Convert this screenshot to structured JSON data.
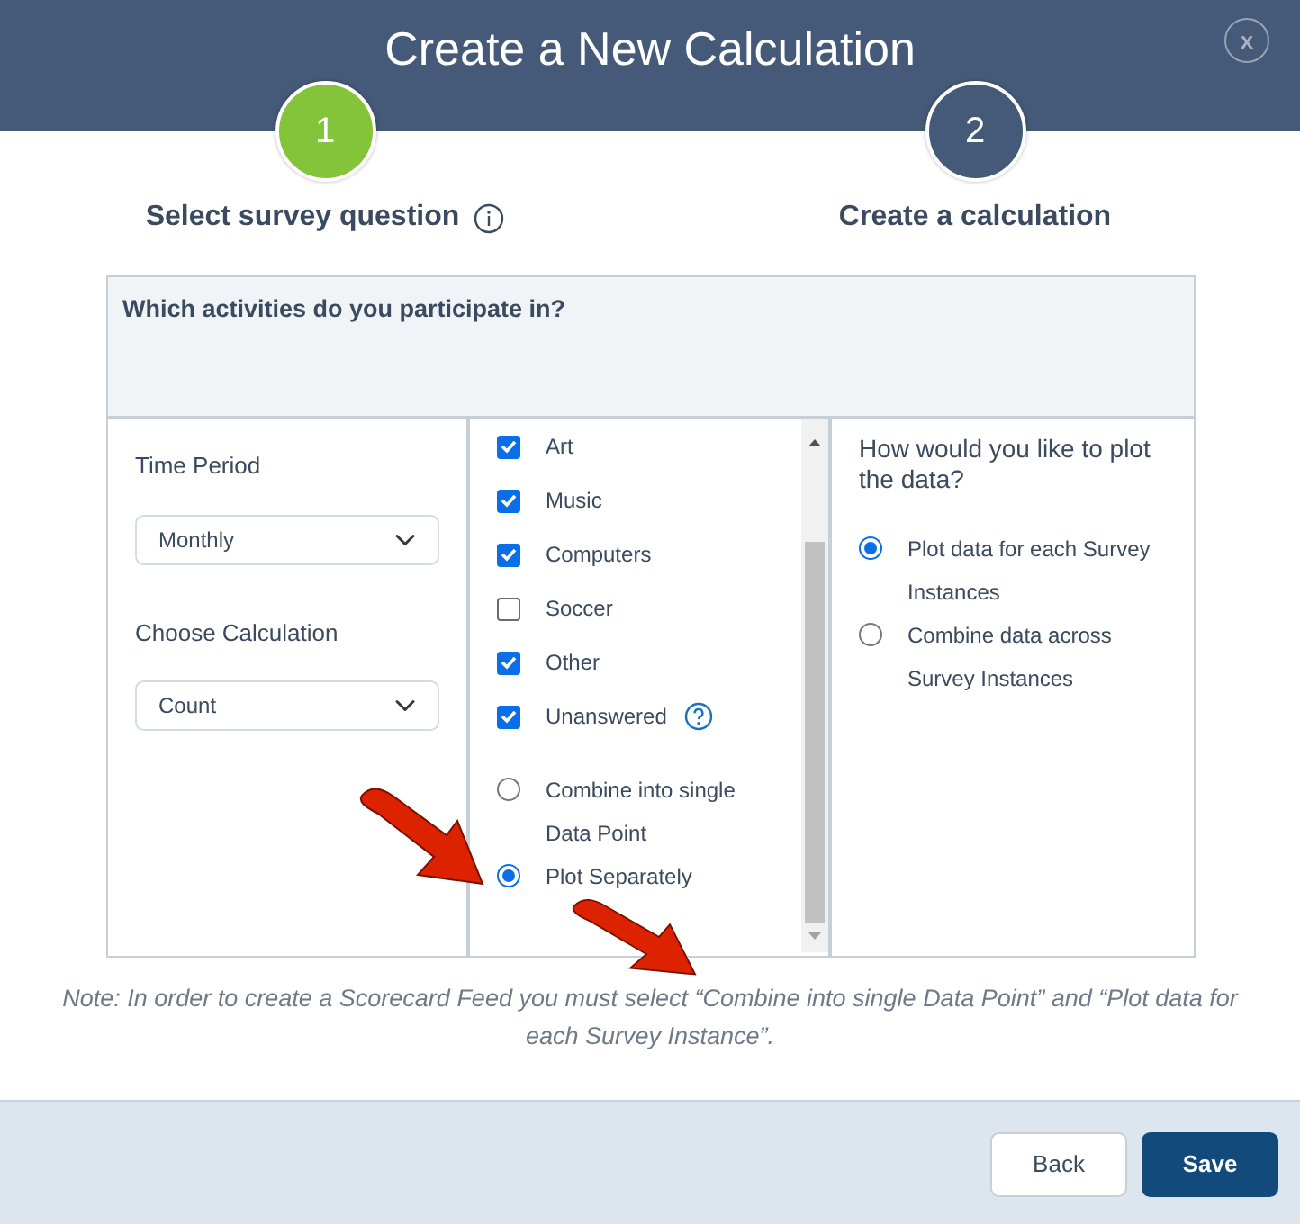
{
  "title": "Create a New Calculation",
  "close_label": "x",
  "steps": [
    {
      "number": "1",
      "label": "Select survey question",
      "active": true,
      "info": true
    },
    {
      "number": "2",
      "label": "Create a calculation",
      "active": false,
      "info": false
    }
  ],
  "question": "Which activities do you participate in?",
  "fields": [
    {
      "label": "Time Period",
      "value": "Monthly"
    },
    {
      "label": "Choose Calculation",
      "value": "Count"
    }
  ],
  "answers": [
    {
      "label": "Art",
      "checked": true,
      "help": false
    },
    {
      "label": "Music",
      "checked": true,
      "help": false
    },
    {
      "label": "Computers",
      "checked": true,
      "help": false
    },
    {
      "label": "Soccer",
      "checked": false,
      "help": false
    },
    {
      "label": "Other",
      "checked": true,
      "help": false
    },
    {
      "label": "Unanswered",
      "checked": true,
      "help": true
    }
  ],
  "grouping": [
    {
      "label": "Combine into single Data Point",
      "selected": false
    },
    {
      "label": "Plot Separately",
      "selected": true
    }
  ],
  "plot": {
    "question": "How would you like to plot the data?",
    "options": [
      {
        "label": "Plot data for each Survey Instances",
        "selected": true
      },
      {
        "label": "Combine data across Survey Instances",
        "selected": false
      }
    ]
  },
  "note": "Note: In order to create a Scorecard Feed you must select “Combine into single Data Point” and “Plot data for each Survey Instance”.",
  "buttons": [
    {
      "label": "Back",
      "kind": "secondary"
    },
    {
      "label": "Save",
      "kind": "primary"
    }
  ]
}
